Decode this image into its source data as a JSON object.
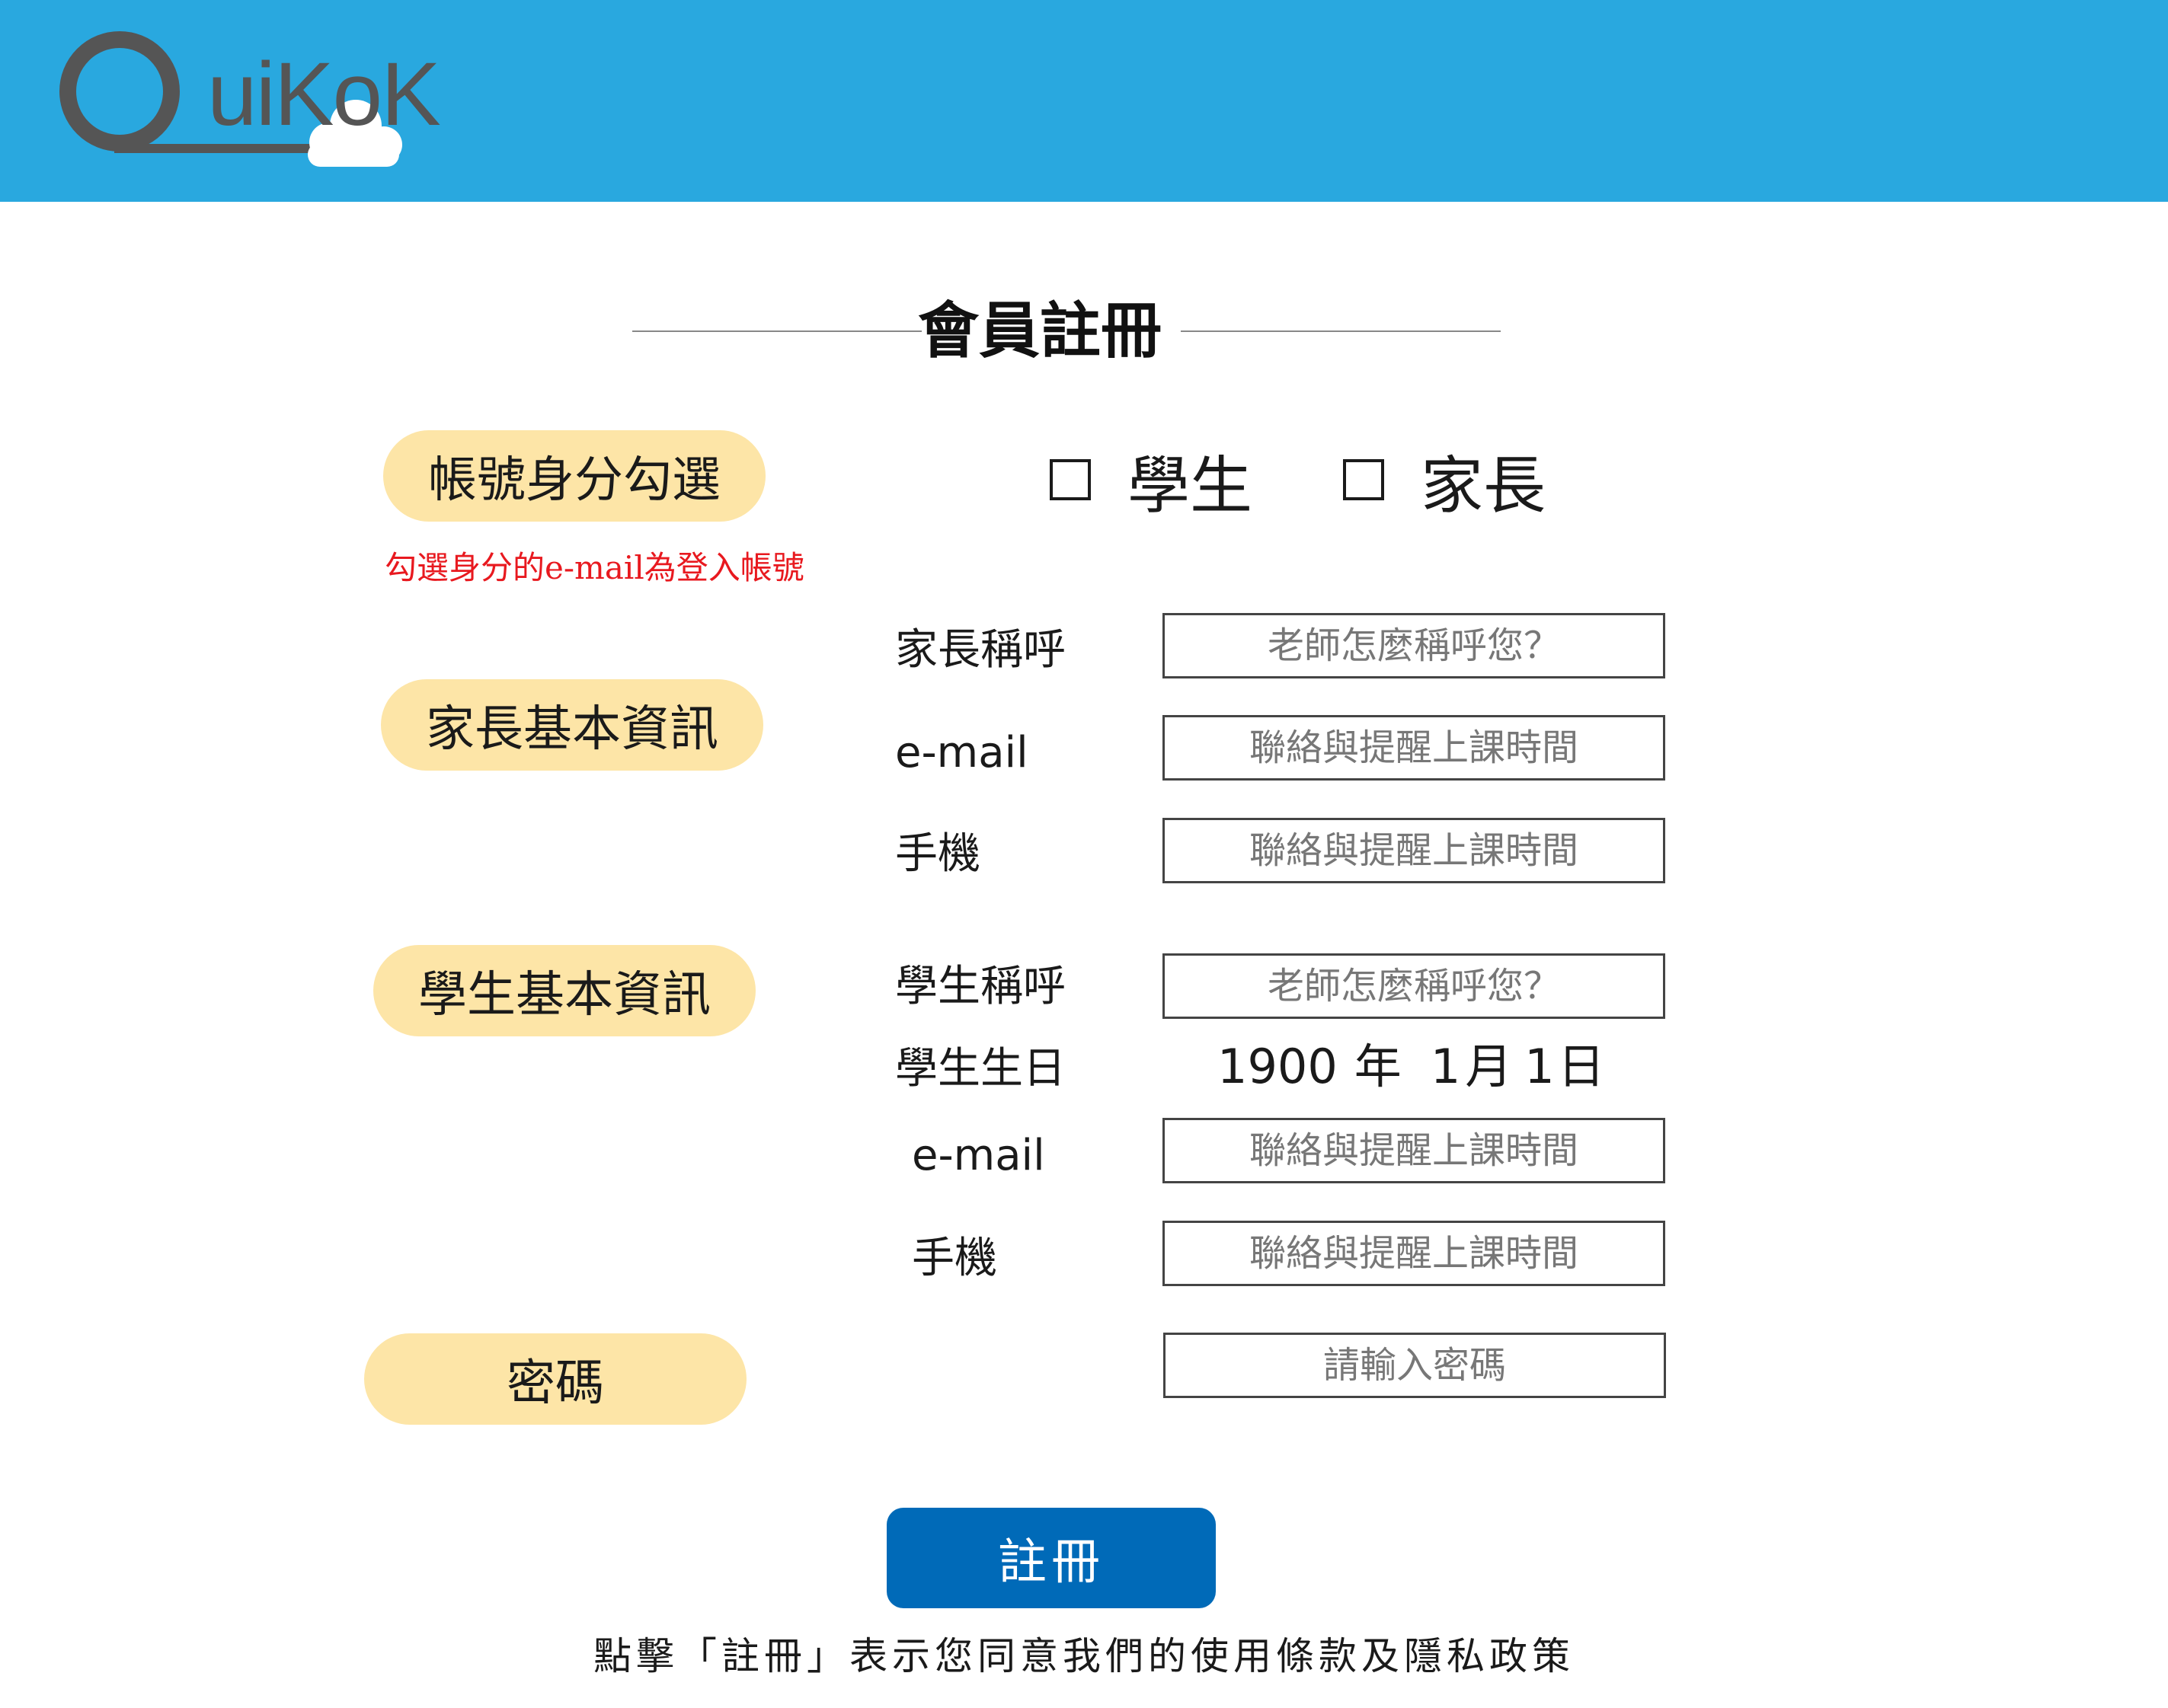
{
  "header": {
    "logo_text": "uiKoK",
    "logo_full": "QuiKoK",
    "background_color": "#29a8df"
  },
  "page_title": "會員註冊",
  "sections": {
    "account_type": {
      "label": "帳號身分勾選",
      "options": [
        "學生",
        "家長"
      ],
      "hint": "勾選身分的e-mail為登入帳號"
    },
    "parent": {
      "label": "家長基本資訊",
      "fields": {
        "name_label": "家長稱呼",
        "name_placeholder": "老師怎麼稱呼您？",
        "email_label": "e-mail",
        "email_placeholder": "聯絡與提醒上課時間",
        "phone_label": "手機",
        "phone_placeholder": "聯絡與提醒上課時間"
      }
    },
    "student": {
      "label": "學生基本資訊",
      "fields": {
        "name_label": "學生稱呼",
        "name_placeholder": "老師怎麼稱呼您？",
        "birthday_label": "學生生日",
        "birthday_year": "1900",
        "birthday_year_unit": "年",
        "birthday_month": "1",
        "birthday_month_unit": "月",
        "birthday_day": "1",
        "birthday_day_unit": "日",
        "email_label": "e-mail",
        "email_placeholder": "聯絡與提醒上課時間",
        "phone_label": "手機",
        "phone_placeholder": "聯絡與提醒上課時間"
      }
    },
    "password": {
      "label": "密碼",
      "placeholder": "請輸入密碼"
    }
  },
  "submit_label": "註冊",
  "terms_text": "點擊「註冊」表示您同意我們的使用條款及隱私政策",
  "colors": {
    "pill": "#fde5a7",
    "button": "#006ab8",
    "hint": "#e8191f"
  }
}
